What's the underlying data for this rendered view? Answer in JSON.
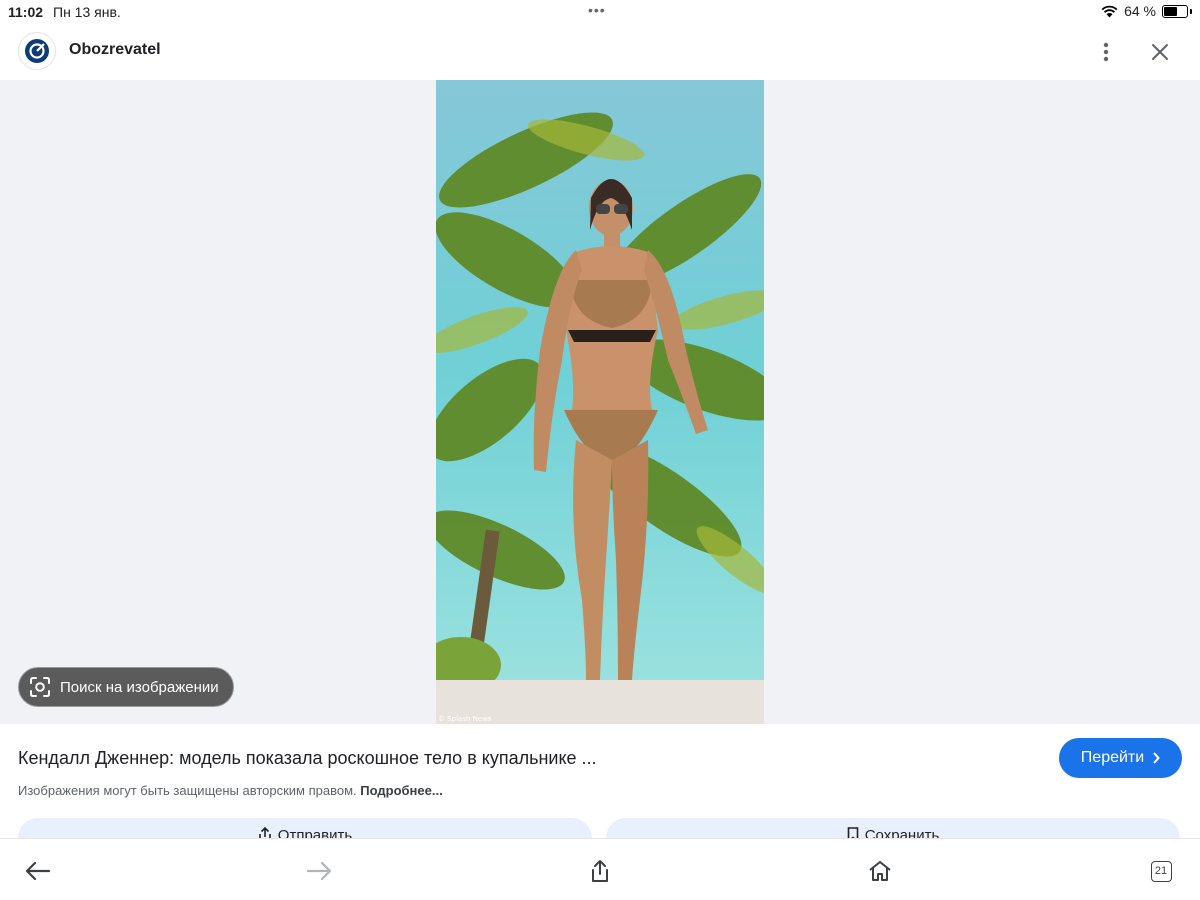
{
  "status": {
    "time": "11:02",
    "date": "Пн 13 янв.",
    "battery_text": "64 %",
    "battery_level": 0.64
  },
  "header": {
    "site_name": "Obozrevatel",
    "icons": [
      "more-vert-icon",
      "close-icon"
    ]
  },
  "viewer": {
    "lens_label": "Поиск на изображении",
    "photo_credit": "© Splash News"
  },
  "info": {
    "title": "Кендалл Дженнер: модель показала роскошное тело в купальнике ...",
    "notice": "Изображения могут быть защищены авторским правом.",
    "more_link": "Подробнее...",
    "go_label": "Перейти",
    "share_label": "Отправить",
    "save_label": "Сохранить"
  },
  "bottom_nav": {
    "tabs_count": "21",
    "icons": [
      "back-arrow-icon",
      "forward-arrow-icon",
      "share-icon",
      "home-icon",
      "tabs-icon"
    ]
  },
  "colors": {
    "accent": "#1a73e8",
    "viewer_bg": "#f0f2f5",
    "pill_bg": "#e8f0fe"
  }
}
